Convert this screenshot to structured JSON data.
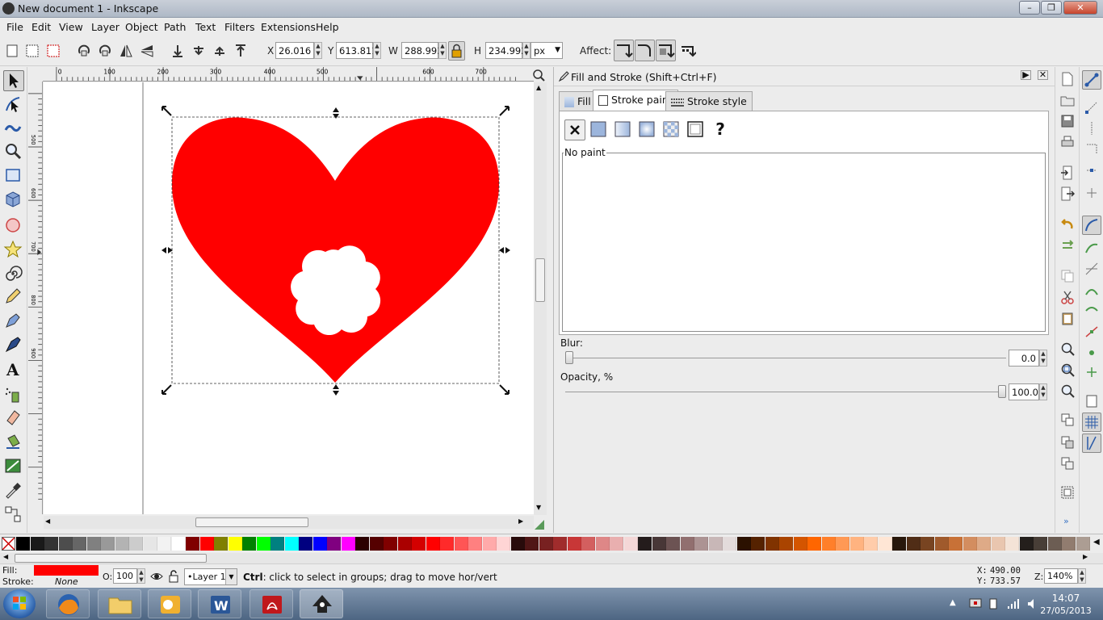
{
  "window": {
    "title": "New document 1 - Inkscape",
    "minimize_icon": "minimize-icon",
    "maximize_icon": "maximize-icon",
    "close_icon": "close-icon"
  },
  "menu": [
    "File",
    "Edit",
    "View",
    "Layer",
    "Object",
    "Path",
    "Text",
    "Filters",
    "Extensions",
    "Help"
  ],
  "toolbar": {
    "x_label": "X",
    "x_value": "26.016",
    "y_label": "Y",
    "y_value": "613.811",
    "w_label": "W",
    "w_value": "288.993",
    "h_label": "H",
    "h_value": "234.992",
    "unit": "px",
    "affect_label": "Affect:"
  },
  "ruler": {
    "h_ticks": [
      "0",
      "100",
      "200",
      "300",
      "400",
      "500",
      "600",
      "700"
    ],
    "v_ticks": [
      "500",
      "600",
      "700",
      "800",
      "900"
    ]
  },
  "panel": {
    "title": "Fill and Stroke (Shift+Ctrl+F)",
    "tabs": [
      "Fill",
      "Stroke paint",
      "Stroke style"
    ],
    "active_tab": "Stroke paint",
    "paint_mode": "No paint",
    "blur_label": "Blur:",
    "blur_value": "0.0",
    "blur_level": 0.0,
    "opacity_label": "Opacity, %",
    "opacity_value": "100.0",
    "opacity_level": 1.0,
    "unknown_paint": "?"
  },
  "status": {
    "fill_label": "Fill:",
    "fill_color": "#ff0000",
    "stroke_label": "Stroke:",
    "stroke_value": "None",
    "opacity_label": "O:",
    "opacity_value": "100",
    "layer": "•Layer 1",
    "hint_bold": "Ctrl",
    "hint_text": ": click to select in groups; drag to move hor/vert",
    "x_label": "X:",
    "x_value": "490.00",
    "y_label": "Y:",
    "y_value": "733.57",
    "zoom_label": "Z:",
    "zoom_value": "140%"
  },
  "taskbar": {
    "time": "14:07",
    "date": "27/05/2013",
    "apps": [
      "windows-start-icon",
      "firefox-icon",
      "explorer-icon",
      "outlook-icon",
      "word-icon",
      "acrobat-icon",
      "inkscape-icon"
    ]
  },
  "colors": {
    "heart": "#ff0000",
    "accent": "#3b74c5"
  },
  "palette": [
    "#000000",
    "#1a1a1a",
    "#333333",
    "#4d4d4d",
    "#666666",
    "#808080",
    "#999999",
    "#b3b3b3",
    "#cccccc",
    "#e6e6e6",
    "#f2f2f2",
    "#ffffff",
    "#800000",
    "#ff0000",
    "#808000",
    "#ffff00",
    "#008000",
    "#00ff00",
    "#008080",
    "#00ffff",
    "#000080",
    "#0000ff",
    "#800080",
    "#ff00ff",
    "#2b0000",
    "#550000",
    "#800000",
    "#aa0000",
    "#d40000",
    "#ff0000",
    "#ff2a2a",
    "#ff5555",
    "#ff8080",
    "#ffaaaa",
    "#ffd5d5",
    "#280b0b",
    "#501616",
    "#782121",
    "#a02c2c",
    "#c83737",
    "#d35f5f",
    "#de8787",
    "#e9afaf",
    "#f4d7d7",
    "#241c1c",
    "#483737",
    "#6c5353",
    "#916f6f",
    "#ac9393",
    "#c8b7b7",
    "#e3dbdb",
    "#2b1100",
    "#552200",
    "#803300",
    "#aa4400",
    "#d45500",
    "#ff6600",
    "#ff7f2a",
    "#ff9955",
    "#ffb380",
    "#ffccaa",
    "#ffe6d5",
    "#28170b",
    "#502d16",
    "#784421",
    "#a05a2c",
    "#c87137",
    "#d38d5f",
    "#deaa87",
    "#e9c6af",
    "#f4e3d7",
    "#241f1c",
    "#483e37",
    "#6c5d53",
    "#917c6f",
    "#ac9d93"
  ]
}
